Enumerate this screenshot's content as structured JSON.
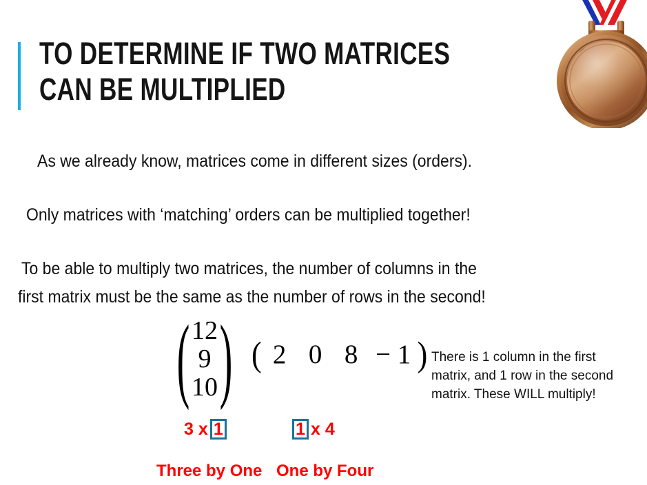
{
  "slide": {
    "title_lines": [
      "To Determine If Two Matrices",
      "Can Be Multiplied"
    ],
    "accent_color": "#1CAFE4",
    "body_paragraphs": [
      "As we already know, matrices come in different sizes (orders).",
      "Only matrices with ‘matching’ orders can be multiplied together!",
      "To be able to multiply two matrices, the number of columns in the",
      "first matrix must be the same as the number of rows in the second!"
    ],
    "math": {
      "left_paren": "(",
      "right_paren": ")",
      "column_matrix": {
        "values": [
          "12",
          "9",
          "10"
        ],
        "rows": 3,
        "columns": 1
      },
      "row_matrix": {
        "values": [
          "2",
          "0",
          "8",
          "− 1"
        ],
        "rows": 1,
        "columns": 4
      }
    },
    "orders": {
      "box_color": "#17749B",
      "red_color": "#FF0000",
      "first": {
        "prefix": "3 x ",
        "boxed": "1",
        "suffix": "",
        "words": "Three by One"
      },
      "second": {
        "prefix": "",
        "boxed": "1",
        "suffix": " x 4",
        "words": "One by Four"
      }
    },
    "explanation": "There is 1 column in the first matrix, and 1 row in the second matrix. These WILL multiply!",
    "decoration": {
      "medal_icon": "bronze-medal-icon",
      "medal_colors": {
        "rim_dark": "#6b3f22",
        "rim_light": "#d9a679",
        "face_light": "#c98a58",
        "face_dark": "#8a4f28"
      },
      "ribbon_colors": {
        "blue": "#1832B4",
        "white": "#FFFFFF",
        "red": "#E21C21"
      }
    }
  }
}
